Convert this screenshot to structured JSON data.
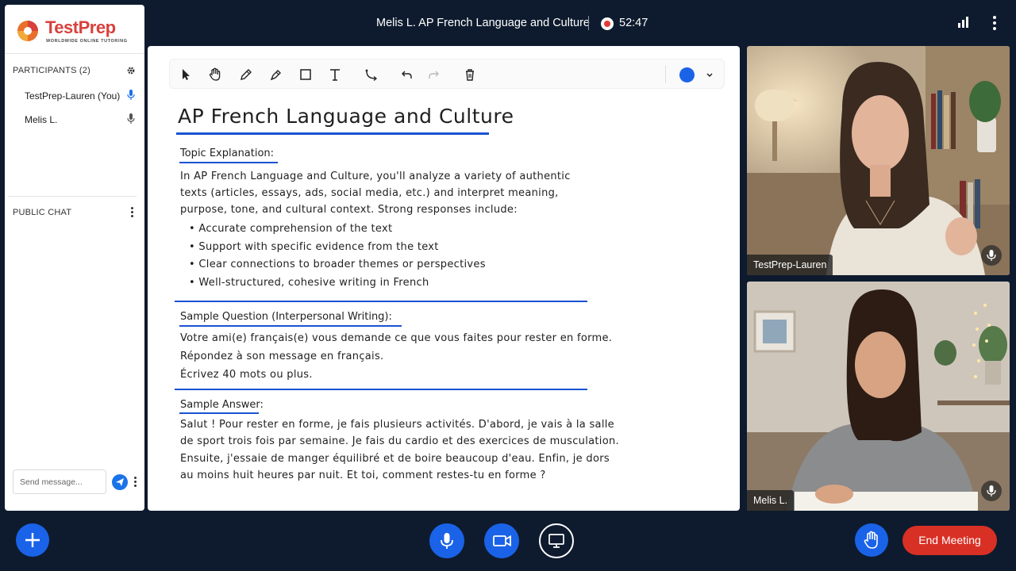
{
  "header": {
    "meeting_title": "Melis L. AP French Language and Culture",
    "recording_time": "52:47"
  },
  "logo": {
    "name": "TestPrep",
    "tagline": "WORLDWIDE ONLINE TUTORING"
  },
  "participants": {
    "heading": "PARTICIPANTS (2)",
    "list": [
      {
        "name": "TestPrep-Lauren (You)",
        "mic_color": "#1a73e8"
      },
      {
        "name": "Melis L.",
        "mic_color": "#555555"
      }
    ]
  },
  "chat": {
    "heading": "PUBLIC CHAT",
    "input_placeholder": "Send message..."
  },
  "toolbar": {
    "tools": [
      "pointer-icon",
      "hand-icon",
      "pencil-icon",
      "marker-icon",
      "rectangle-icon",
      "text-icon",
      "connector-icon",
      "undo-icon",
      "redo-icon",
      "delete-icon"
    ],
    "selected_color": "#1a63e8"
  },
  "whiteboard": {
    "title": "AP French Language and Culture",
    "topic_heading": "Topic Explanation:",
    "topic_lines": [
      "In AP French Language and Culture, you'll analyze a variety of authentic",
      "texts (articles, essays, ads, social media, etc.) and interpret meaning,",
      "purpose, tone, and cultural context. Strong responses include:"
    ],
    "bullets": [
      "Accurate comprehension of the text",
      "Support with specific evidence from the text",
      "Clear connections to broader themes or perspectives",
      "Well-structured, cohesive writing in French"
    ],
    "question_heading": "Sample Question (Interpersonal Writing):",
    "question_lines": [
      "Votre ami(e) français(e) vous demande ce que vous faites pour rester en forme.",
      "Répondez à son message en français.",
      "Écrivez 40 mots ou plus."
    ],
    "answer_heading": "Sample Answer:",
    "answer_lines": [
      "Salut ! Pour rester en forme, je fais plusieurs activités. D'abord, je vais à la salle",
      "de sport trois fois par semaine. Je fais du cardio et des exercices de musculation.",
      "Ensuite, j'essaie de manger équilibré et de boire beaucoup d'eau. Enfin, je dors",
      "au moins huit heures par nuit. Et toi, comment restes-tu en forme ?"
    ]
  },
  "videos": [
    {
      "name": "TestPrep-Lauren"
    },
    {
      "name": "Melis L."
    }
  ],
  "controls": {
    "end_meeting": "End Meeting",
    "accent": "#1a63e8",
    "danger": "#d93025"
  }
}
